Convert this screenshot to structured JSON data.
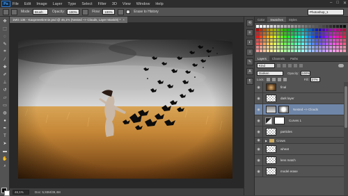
{
  "app": {
    "logo_text": "Ps",
    "menus": [
      "File",
      "Edit",
      "Image",
      "Layer",
      "Type",
      "Select",
      "Filter",
      "3D",
      "View",
      "Window",
      "Help"
    ],
    "window_controls": [
      "–",
      "□",
      "✕"
    ]
  },
  "options_bar": {
    "mode_label": "Mode:",
    "mode_value": "Brush",
    "opacity_label": "Opacity:",
    "opacity_value": "100%",
    "flow_label": "Flow:",
    "flow_value": "100%",
    "erase_history_label": "Erase to History",
    "workspace_value": "Photoshop_1"
  },
  "document": {
    "tab_title": "1MG 136 - Kaopreeekrenie.psd @ 46,1% (Nested ~> Clouds, Layer Mask/8) *",
    "close_glyph": "×"
  },
  "status": {
    "zoom": "46,1%",
    "doc_info": "Doc: 5,93M/39,4M"
  },
  "tools": [
    "move",
    "marquee",
    "lasso",
    "quick-select",
    "crop",
    "eyedropper",
    "heal",
    "brush",
    "stamp",
    "history-brush",
    "eraser",
    "gradient",
    "blur",
    "dodge",
    "pen",
    "type",
    "path-select",
    "shape",
    "hand",
    "zoom"
  ],
  "panels": {
    "swatch_tabs": [
      "Color",
      "Swatches",
      "Styles"
    ],
    "active_swatch_tab": "Swatches",
    "layer_tabs": [
      "Layers",
      "Channels",
      "Paths"
    ],
    "kind_label": "Kind",
    "blend_mode": "Darken",
    "opacity_label": "Opacity:",
    "opacity_value": "100%",
    "lock_label": "Lock:",
    "fill_label": "Fill:",
    "fill_value": "27%"
  },
  "layers": [
    {
      "name": "final",
      "type": "image",
      "thumb": "img1",
      "visible": true
    },
    {
      "name": "dark layer",
      "type": "checker",
      "thumb": "chk",
      "visible": true
    },
    {
      "name": "Nested ~> Clouds",
      "type": "image+mask",
      "thumb": "img2",
      "visible": true,
      "selected": true
    },
    {
      "name": "Curves 1",
      "type": "adjustment",
      "visible": true
    },
    {
      "name": "particles",
      "type": "checker",
      "thumb": "chk",
      "visible": true
    },
    {
      "name": "Crows",
      "type": "group",
      "visible": true
    },
    {
      "name": "wheat",
      "type": "checker",
      "thumb": "chk",
      "visible": true
    },
    {
      "name": "lens match",
      "type": "checker",
      "thumb": "chk",
      "visible": true
    },
    {
      "name": "model erase",
      "type": "checker",
      "thumb": "chk",
      "visible": true
    }
  ]
}
